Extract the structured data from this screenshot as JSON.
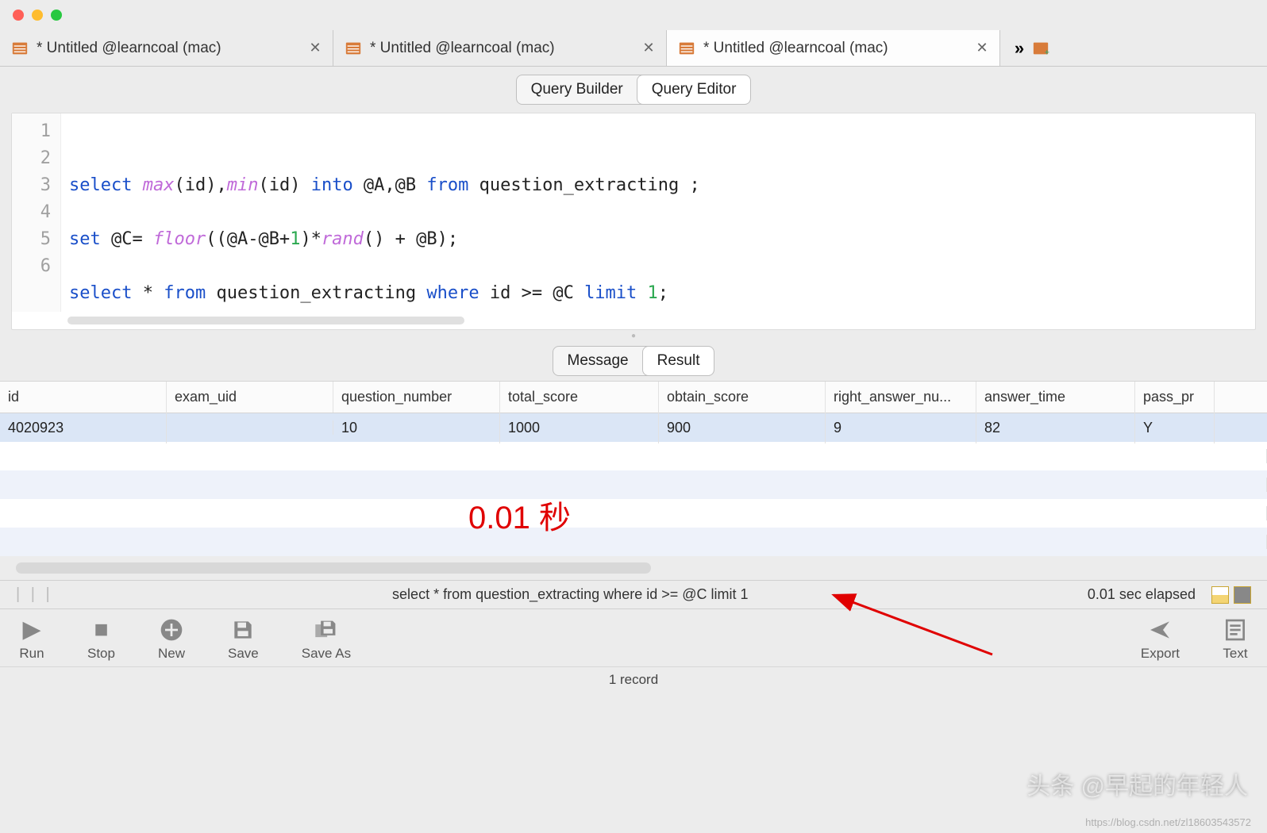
{
  "tabs": [
    {
      "label": "* Untitled @learncoal (mac)"
    },
    {
      "label": "* Untitled @learncoal (mac)"
    },
    {
      "label": "* Untitled @learncoal (mac)"
    }
  ],
  "mode_toggle": {
    "builder": "Query Builder",
    "editor": "Query Editor"
  },
  "code": {
    "lines": [
      "1",
      "2",
      "3",
      "4",
      "5",
      "6"
    ]
  },
  "sql": {
    "l2_select": "select",
    "l2_max": "max",
    "l2_id1": "(id),",
    "l2_min": "min",
    "l2_id2": "(id) ",
    "l2_into": "into",
    "l2_vars": " @A,@B ",
    "l2_from": "from",
    "l2_tbl": " question_extracting ;",
    "l4_set": "set",
    "l4_c": " @C= ",
    "l4_floor": "floor",
    "l4_p1": "((@A-@B+",
    "l4_one": "1",
    "l4_p2": ")*",
    "l4_rand": "rand",
    "l4_p3": "() + @B);",
    "l6_select": "select",
    "l6_star": " * ",
    "l6_from": "from",
    "l6_tbl": " question_extracting ",
    "l6_where": "where",
    "l6_cond": " id >= @C ",
    "l6_limit": "limit",
    "l6_sp": " ",
    "l6_n": "1",
    "l6_semi": ";"
  },
  "result_toggle": {
    "message": "Message",
    "result": "Result"
  },
  "columns": [
    "id",
    "exam_uid",
    "question_number",
    "total_score",
    "obtain_score",
    "right_answer_nu...",
    "answer_time",
    "pass_pr"
  ],
  "row": {
    "id": "4020923",
    "exam_uid": "",
    "question_number": "10",
    "total_score": "1000",
    "obtain_score": "900",
    "right_answer": "9",
    "answer_time": "82",
    "pass_pr": "Y"
  },
  "annotation": "0.01 秒",
  "status": {
    "query": "select * from question_extracting where id >= @C limit 1",
    "elapsed": "0.01 sec elapsed"
  },
  "tools": {
    "run": "Run",
    "stop": "Stop",
    "new": "New",
    "save": "Save",
    "saveas": "Save As",
    "export": "Export",
    "text": "Text"
  },
  "footer": "1 record",
  "watermark": "头条 @早起的年轻人",
  "watermark2": "https://blog.csdn.net/zl18603543572"
}
